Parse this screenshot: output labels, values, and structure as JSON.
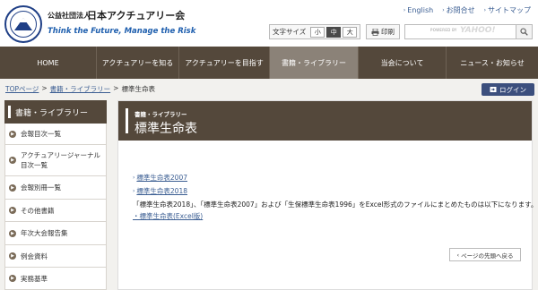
{
  "header": {
    "org_prefix": "公益社団法人",
    "org_name": "日本アクチュアリー会",
    "tagline": "Think the Future, Manage the Risk",
    "top_links": [
      "English",
      "お問合せ",
      "サイトマップ"
    ],
    "fontsize": {
      "label": "文字サイズ",
      "options": [
        "小",
        "中",
        "大"
      ],
      "selected": "中"
    },
    "print_label": "印刷",
    "search": {
      "placeholder": "",
      "powered_by": "POWERED BY",
      "provider": "YAHOO!"
    }
  },
  "nav": {
    "items": [
      "HOME",
      "アクチュアリーを知る",
      "アクチュアリーを目指す",
      "書籍・ライブラリー",
      "当会について",
      "ニュース・お知らせ"
    ],
    "active_index": 3
  },
  "breadcrumb": [
    "TOPページ",
    "書籍・ライブラリー",
    "標準生命表"
  ],
  "login_label": "ログイン",
  "sidebar": {
    "title": "書籍・ライブラリー",
    "items": [
      {
        "label": "会報目次一覧"
      },
      {
        "label": "アクチュアリージャーナル目次一覧"
      },
      {
        "label": "会報別冊一覧"
      },
      {
        "label": "その他書籍"
      },
      {
        "label": "年次大会報告集"
      },
      {
        "label": "例会資料"
      },
      {
        "label": "実務基準"
      }
    ]
  },
  "main": {
    "subtitle": "書籍・ライブラリー",
    "title": "標準生命表",
    "links": [
      "標準生命表2007",
      "標準生命表2018"
    ],
    "description": "「標準生命表2018」、「標準生命表2007」および「生保標準生命表1996」をExcel形式のファイルにまとめたものは以下になります。",
    "excel_link": "・標準生命表(Excel版)",
    "back_to_top": "ページの先頭へ戻る"
  },
  "colors": {
    "nav_bg": "#54483b",
    "nav_active": "#8b8278",
    "link": "#3a5d92",
    "tagline": "#1f5fae",
    "login_bg": "#3c4f7d",
    "page_bg": "#f2f1ee"
  }
}
